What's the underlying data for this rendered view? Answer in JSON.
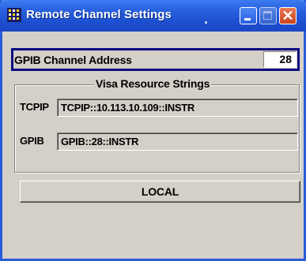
{
  "window": {
    "title": "Remote Channel Settings",
    "icon": "app-grid-icon",
    "controls": {
      "minimize": "minimize-icon",
      "maximize": "maximize-icon",
      "close_glyph": "✕"
    }
  },
  "gpib": {
    "label": "GPIB Channel Address",
    "value": "28"
  },
  "visa": {
    "legend": "Visa Resource Strings",
    "rows": [
      {
        "label": "TCPIP",
        "value": "TCPIP::10.113.10.109::INSTR"
      },
      {
        "label": "GPIB",
        "value": "GPIB::28::INSTR"
      }
    ]
  },
  "local_button": {
    "label": "LOCAL"
  },
  "colors": {
    "title_bar": "#2a62e0",
    "frame": "#2a5bd7",
    "panel": "#d4d0c8",
    "focus_border": "#0a0a80",
    "close_button": "#c9441f"
  }
}
